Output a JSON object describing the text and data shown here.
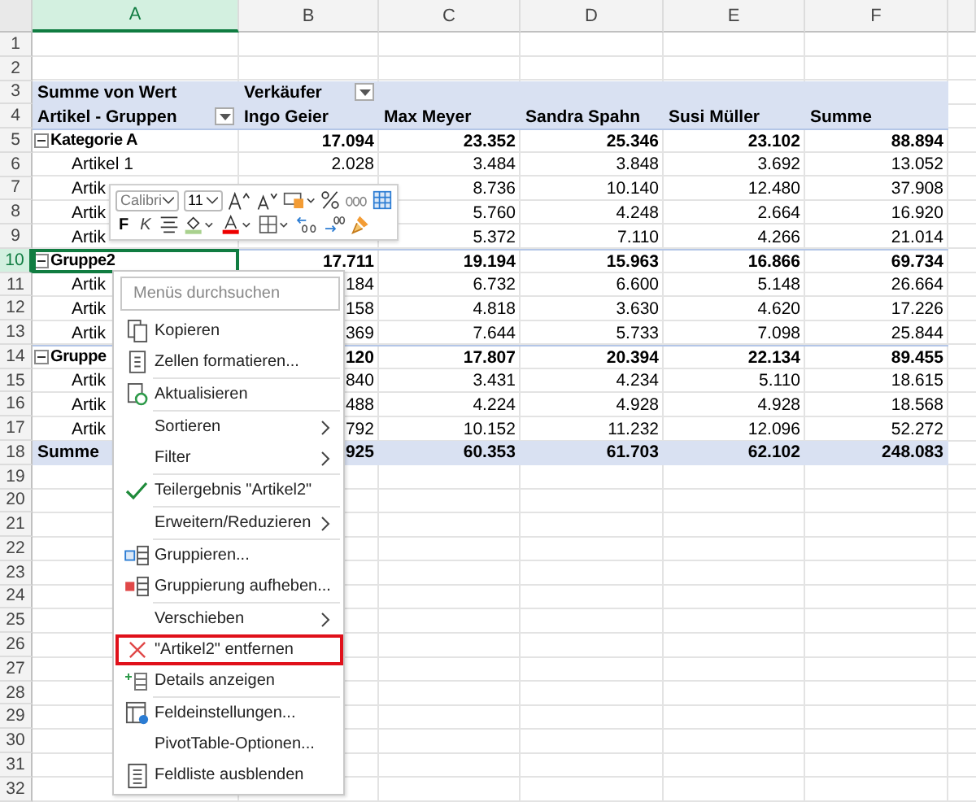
{
  "columns": [
    {
      "label": "A",
      "selected": true
    },
    {
      "label": "B",
      "selected": false
    },
    {
      "label": "C",
      "selected": false
    },
    {
      "label": "D",
      "selected": false
    },
    {
      "label": "E",
      "selected": false
    },
    {
      "label": "F",
      "selected": false
    }
  ],
  "rows": [
    {
      "number": "1",
      "kind": "blank",
      "selected": false
    },
    {
      "number": "2",
      "kind": "blank",
      "selected": false
    },
    {
      "number": "3",
      "kind": "pivot_header",
      "selected": false,
      "cells": [
        "Summe von Wert",
        {
          "text": "Verkäufer",
          "dropdown": true
        }
      ]
    },
    {
      "number": "4",
      "kind": "pivot_header",
      "selected": false,
      "cells": [
        {
          "text": "Artikel - Gruppen",
          "dropdown": true
        },
        "Ingo Geier",
        "Max Meyer",
        "Sandra Spahn",
        "Susi Müller",
        "Summe"
      ]
    },
    {
      "number": "5",
      "kind": "group",
      "selected": false,
      "cells": [
        "Kategorie A",
        "17.094",
        "23.352",
        "25.346",
        "23.102",
        "88.894"
      ]
    },
    {
      "number": "6",
      "kind": "item",
      "selected": false,
      "cells": [
        "Artikel 1",
        "2.028",
        "3.484",
        "3.848",
        "3.692",
        "13.052"
      ]
    },
    {
      "number": "7",
      "kind": "item",
      "selected": false,
      "cells": [
        "Artik",
        null,
        "8.736",
        "10.140",
        "12.480",
        "37.908"
      ]
    },
    {
      "number": "8",
      "kind": "item",
      "selected": false,
      "cells": [
        "Artik",
        null,
        "5.760",
        "4.248",
        "2.664",
        "16.920"
      ]
    },
    {
      "number": "9",
      "kind": "item",
      "selected": false,
      "cells": [
        "Artik",
        null,
        "5.372",
        "7.110",
        "4.266",
        "21.014"
      ]
    },
    {
      "number": "10",
      "kind": "group",
      "selected": true,
      "cells": [
        "Gruppe2",
        "17.711",
        "19.194",
        "15.963",
        "16.866",
        "69.734"
      ]
    },
    {
      "number": "11",
      "kind": "item",
      "selected": false,
      "cells": [
        "Artik",
        "184",
        "6.732",
        "6.600",
        "5.148",
        "26.664"
      ]
    },
    {
      "number": "12",
      "kind": "item",
      "selected": false,
      "cells": [
        "Artik",
        "158",
        "4.818",
        "3.630",
        "4.620",
        "17.226"
      ]
    },
    {
      "number": "13",
      "kind": "item",
      "selected": false,
      "cells": [
        "Artik",
        "369",
        "7.644",
        "5.733",
        "7.098",
        "25.844"
      ]
    },
    {
      "number": "14",
      "kind": "group",
      "selected": false,
      "cells": [
        "Gruppe",
        "120",
        "17.807",
        "20.394",
        "22.134",
        "89.455"
      ]
    },
    {
      "number": "15",
      "kind": "item",
      "selected": false,
      "cells": [
        "Artik",
        "840",
        "3.431",
        "4.234",
        "5.110",
        "18.615"
      ]
    },
    {
      "number": "16",
      "kind": "item",
      "selected": false,
      "cells": [
        "Artik",
        "488",
        "4.224",
        "4.928",
        "4.928",
        "18.568"
      ]
    },
    {
      "number": "17",
      "kind": "item",
      "selected": false,
      "cells": [
        "Artik",
        "792",
        "10.152",
        "11.232",
        "12.096",
        "52.272"
      ]
    },
    {
      "number": "18",
      "kind": "total",
      "selected": false,
      "cells": [
        "Summe",
        "925",
        "60.353",
        "61.703",
        "62.102",
        "248.083"
      ]
    },
    {
      "number": "19",
      "kind": "blank",
      "selected": false
    },
    {
      "number": "20",
      "kind": "blank",
      "selected": false
    },
    {
      "number": "21",
      "kind": "blank",
      "selected": false
    },
    {
      "number": "22",
      "kind": "blank",
      "selected": false
    },
    {
      "number": "23",
      "kind": "blank",
      "selected": false
    },
    {
      "number": "24",
      "kind": "blank",
      "selected": false
    },
    {
      "number": "25",
      "kind": "blank",
      "selected": false
    },
    {
      "number": "26",
      "kind": "blank",
      "selected": false
    },
    {
      "number": "27",
      "kind": "blank",
      "selected": false
    },
    {
      "number": "28",
      "kind": "blank",
      "selected": false
    },
    {
      "number": "29",
      "kind": "blank",
      "selected": false
    },
    {
      "number": "30",
      "kind": "blank",
      "selected": false
    },
    {
      "number": "31",
      "kind": "blank",
      "selected": false
    },
    {
      "number": "32",
      "kind": "blank",
      "selected": false
    }
  ],
  "mini_toolbar": {
    "font": "Calibri",
    "size": "11",
    "bold": "F",
    "italic": "K"
  },
  "context_menu": {
    "search": {
      "placeholder": "Menüs durchsuchen"
    },
    "items": [
      {
        "label": "Kopieren",
        "kind": "command",
        "separator_before": false,
        "selected": false
      },
      {
        "label": "Zellen formatieren...",
        "kind": "command",
        "separator_before": false,
        "selected": false
      },
      {
        "label": "Aktualisieren",
        "kind": "command",
        "separator_before": true,
        "selected": false
      },
      {
        "label": "Sortieren",
        "kind": "submenu",
        "separator_before": true,
        "selected": false
      },
      {
        "label": "Filter",
        "kind": "submenu",
        "separator_before": false,
        "selected": false
      },
      {
        "label": "Teilergebnis \"Artikel2\"",
        "kind": "check",
        "checked": true,
        "separator_before": true,
        "selected": false
      },
      {
        "label": "Erweitern/Reduzieren",
        "kind": "submenu",
        "separator_before": true,
        "selected": false
      },
      {
        "label": "Gruppieren...",
        "kind": "command",
        "separator_before": true,
        "selected": false
      },
      {
        "label": "Gruppierung aufheben...",
        "kind": "command",
        "separator_before": false,
        "selected": false
      },
      {
        "label": "Verschieben",
        "kind": "submenu",
        "separator_before": true,
        "selected": false
      },
      {
        "label": "\"Artikel2\" entfernen",
        "kind": "command",
        "separator_before": false,
        "selected": true
      },
      {
        "label": "Details anzeigen",
        "kind": "command",
        "separator_before": false,
        "selected": false
      },
      {
        "label": "Feldeinstellungen...",
        "kind": "command",
        "separator_before": true,
        "selected": false
      },
      {
        "label": "PivotTable-Optionen...",
        "kind": "command",
        "separator_before": false,
        "selected": false
      },
      {
        "label": "Feldliste ausblenden",
        "kind": "command",
        "separator_before": false,
        "selected": false
      }
    ]
  }
}
